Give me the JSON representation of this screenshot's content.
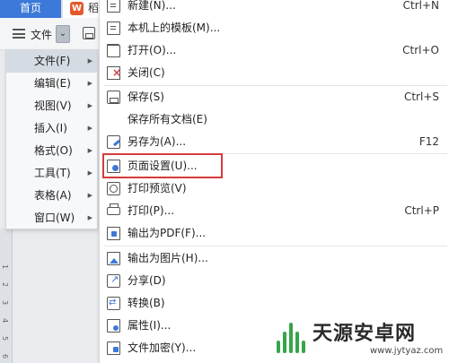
{
  "tabs": {
    "home": "首页",
    "doc_prefix": "稻",
    "doc_logo": "W"
  },
  "toolbar": {
    "file_label": "文件",
    "dropdown_glyph": "⌄"
  },
  "submenu": [
    {
      "label": "文件(F)",
      "active": true
    },
    {
      "label": "编辑(E)"
    },
    {
      "label": "视图(V)"
    },
    {
      "label": "插入(I)"
    },
    {
      "label": "格式(O)"
    },
    {
      "label": "工具(T)"
    },
    {
      "label": "表格(A)"
    },
    {
      "label": "窗口(W)"
    }
  ],
  "submenu_arrow": "▶",
  "filemenu": [
    {
      "icon": "new-document-icon",
      "label": "新建(N)...",
      "shortcut": "Ctrl+N"
    },
    {
      "icon": "template-icon",
      "label": "本机上的模板(M)...",
      "shortcut": ""
    },
    {
      "icon": "open-folder-icon",
      "label": "打开(O)...",
      "shortcut": "Ctrl+O"
    },
    {
      "icon": "close-document-icon",
      "label": "关闭(C)",
      "shortcut": ""
    },
    {
      "icon": "save-icon",
      "label": "保存(S)",
      "shortcut": "Ctrl+S"
    },
    {
      "icon": "",
      "label": "保存所有文档(E)",
      "shortcut": ""
    },
    {
      "icon": "save-as-icon",
      "label": "另存为(A)...",
      "shortcut": "F12"
    },
    {
      "icon": "page-setup-icon",
      "label": "页面设置(U)...",
      "shortcut": ""
    },
    {
      "icon": "print-preview-icon",
      "label": "打印预览(V)",
      "shortcut": ""
    },
    {
      "icon": "print-icon",
      "label": "打印(P)...",
      "shortcut": "Ctrl+P"
    },
    {
      "icon": "export-pdf-icon",
      "label": "输出为PDF(F)...",
      "shortcut": ""
    },
    {
      "icon": "export-image-icon",
      "label": "输出为图片(H)...",
      "shortcut": ""
    },
    {
      "icon": "share-icon",
      "label": "分享(D)",
      "shortcut": ""
    },
    {
      "icon": "convert-icon",
      "label": "转换(B)",
      "shortcut": ""
    },
    {
      "icon": "properties-icon",
      "label": "属性(I)...",
      "shortcut": ""
    },
    {
      "icon": "encrypt-icon",
      "label": "文件加密(Y)...",
      "shortcut": ""
    }
  ],
  "highlighted_item": "页面设置(U)...",
  "ruler_ticks": [
    "1",
    "2",
    "3",
    "4",
    "5",
    "6"
  ],
  "watermark": {
    "title": "天源安卓网",
    "url": "www.jytyaz.com"
  },
  "colors": {
    "accent": "#3d79d8",
    "highlight_border": "#d63b3b",
    "watermark_green": "#35a54a"
  }
}
